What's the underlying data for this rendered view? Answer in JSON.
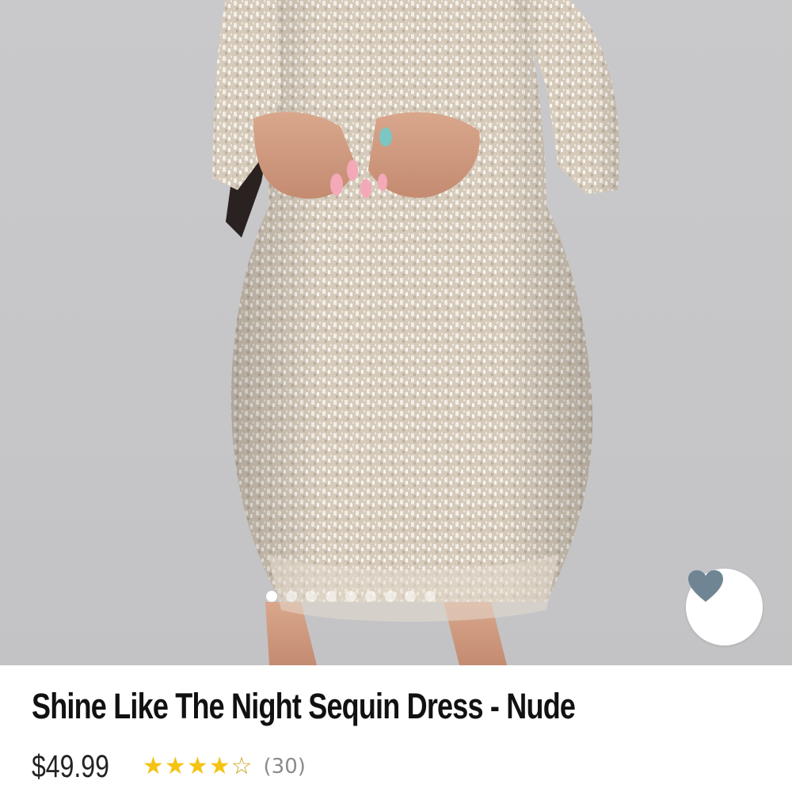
{
  "product": {
    "title": "Shine Like The Night Sequin Dress - Nude",
    "price": "$49.99",
    "rating": 4,
    "rating_max": 5,
    "review_count": "(30)"
  },
  "gallery": {
    "image_count": 9,
    "active_index": 0
  },
  "favorite": {
    "icon": "heart-icon",
    "icon_color": "#6f8594"
  },
  "colors": {
    "star": "#f4c313",
    "background": "#c8c8ca"
  }
}
